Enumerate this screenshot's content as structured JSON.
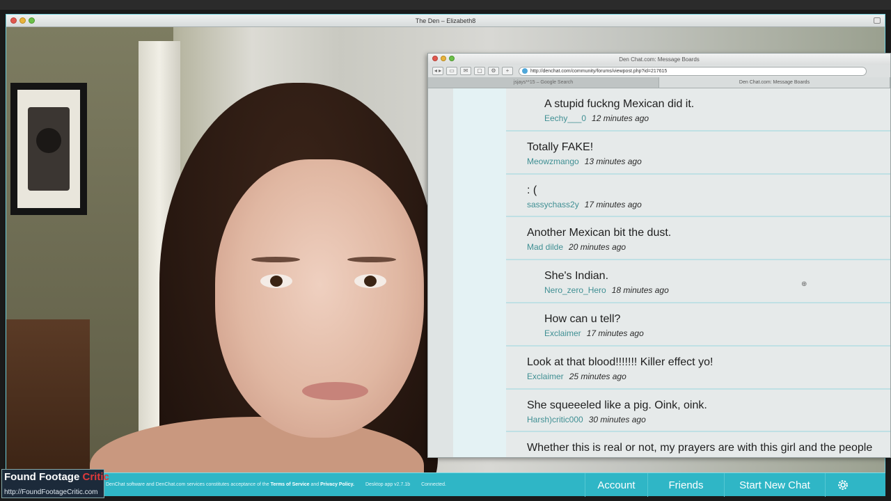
{
  "app": {
    "title": "The Den – Elizabeth8"
  },
  "browser": {
    "title": "Den Chat.com: Message Boards",
    "url": "http://denchat.com/community/forums/viewpost.php?id=217615",
    "tabs": [
      {
        "label": "jsjays**15 – Google Search"
      },
      {
        "label": "Den Chat.com: Message Boards"
      }
    ]
  },
  "posts": [
    {
      "text": "A stupid fuckng Mexican did it.",
      "user": "Eechy___0",
      "time": "12 minutes ago",
      "reply": true
    },
    {
      "text": "Totally FAKE!",
      "user": "Meowzmango",
      "time": "13 minutes ago",
      "reply": false
    },
    {
      "text": ": (",
      "user": "sassychass2y",
      "time": "17 minutes ago",
      "reply": false
    },
    {
      "text": "Another Mexican bit the dust.",
      "user": "Mad dilde",
      "time": "20 minutes ago",
      "reply": false
    },
    {
      "text": "She's Indian.",
      "user": "Nero_zero_Hero",
      "time": "18 minutes ago",
      "reply": true
    },
    {
      "text": "How can u tell?",
      "user": "Exclaimer",
      "time": "17 minutes ago",
      "reply": true
    },
    {
      "text": "Look at that blood!!!!!!! Killer effect yo!",
      "user": "Exclaimer",
      "time": "25 minutes ago",
      "reply": false
    },
    {
      "text": "She squeeeled like a pig.  Oink, oink.",
      "user": "Harsh)critic000",
      "time": "30 minutes ago",
      "reply": false
    },
    {
      "text": "Whether this is real or not, my prayers are with this girl and the people",
      "user": "",
      "time": "",
      "reply": false
    }
  ],
  "bottom_bar": {
    "legal_prefix": "DenChat software and DenChat.com services constitutes acceptance of the",
    "terms": "Terms of Service",
    "and": "and",
    "privacy": "Privacy Policy.",
    "version": "Desktop app v2.7.1b",
    "status": "Connected.",
    "account": "Account",
    "friends": "Friends",
    "new_chat": "Start New Chat",
    "settings_icon": "gear-icon"
  },
  "watermark": {
    "title_a": "Found Footage",
    "title_b": "Critic",
    "url": "http://FoundFootageCritic.com"
  },
  "colors": {
    "accent": "#2fb6c6",
    "username": "#3f8f93"
  }
}
